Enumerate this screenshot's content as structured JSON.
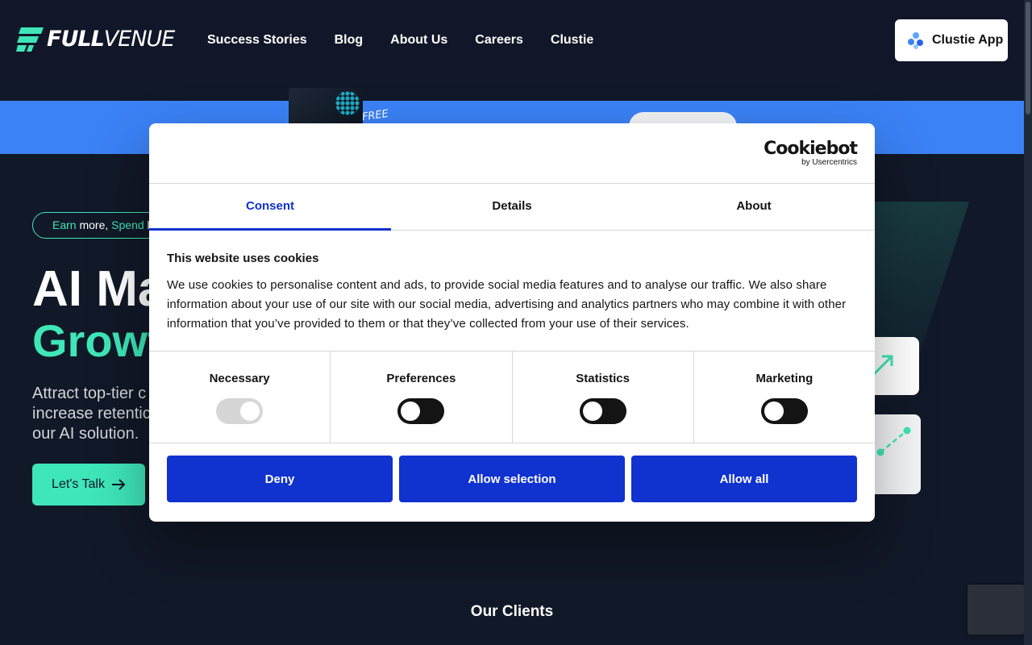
{
  "header": {
    "logo_bold": "FULL",
    "logo_light": "VENUE",
    "nav": [
      "Success Stories",
      "Blog",
      "About Us",
      "Careers",
      "Clustie"
    ],
    "app_button": "Clustie App"
  },
  "banner": {
    "free_tag": "FREE"
  },
  "hero": {
    "tagline_earn": "Earn",
    "tagline_more": " more, ",
    "tagline_spend": "Spend",
    "tagline_less": " les",
    "title_line1": "AI Ma",
    "title_line2": "Growt",
    "subtitle": "Attract top-tier c increase retentic our AI solution.",
    "cta": "Let's Talk"
  },
  "clients_heading": "Our Clients",
  "cookie_dialog": {
    "brand": "Cookiebot",
    "brand_sub": "by Usercentrics",
    "tabs": [
      "Consent",
      "Details",
      "About"
    ],
    "active_tab": "Consent",
    "heading": "This website uses cookies",
    "body": "We use cookies to personalise content and ads, to provide social media features and to analyse our traffic. We also share information about your use of our site with our social media, advertising and analytics partners who may combine it with other information that you’ve provided to them or that they’ve collected from your use of their services.",
    "categories": [
      {
        "label": "Necessary",
        "checked": true,
        "disabled": true
      },
      {
        "label": "Preferences",
        "checked": false,
        "disabled": false
      },
      {
        "label": "Statistics",
        "checked": false,
        "disabled": false
      },
      {
        "label": "Marketing",
        "checked": false,
        "disabled": false
      }
    ],
    "buttons": [
      "Deny",
      "Allow selection",
      "Allow all"
    ]
  },
  "colors": {
    "accent": "#3ee6b8",
    "dialog_blue": "#1032cf",
    "banner_blue": "#3b82f6",
    "page_bg": "#111827"
  }
}
